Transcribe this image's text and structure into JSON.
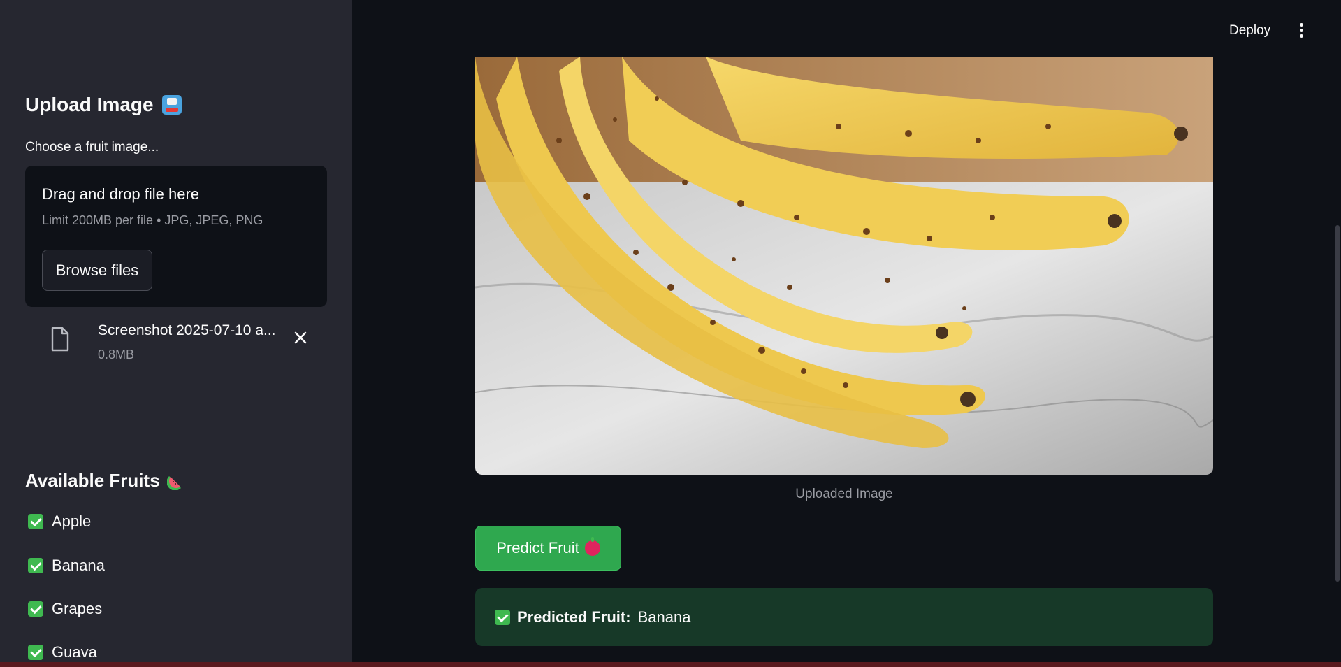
{
  "sidebar": {
    "upload_title": "Upload Image",
    "choose_label": "Choose a fruit image...",
    "dropzone": {
      "title": "Drag and drop file here",
      "limit": "Limit 200MB per file • JPG, JPEG, PNG",
      "browse_label": "Browse files"
    },
    "file": {
      "name": "Screenshot 2025-07-10 a...",
      "size": "0.8MB"
    },
    "fruits_title": "Available Fruits",
    "fruits": [
      "Apple",
      "Banana",
      "Grapes",
      "Guava"
    ]
  },
  "header": {
    "deploy_label": "Deploy"
  },
  "main": {
    "image_caption": "Uploaded Image",
    "predict_label": "Predict Fruit",
    "result_label": "Predicted Fruit:",
    "result_value": "Banana"
  },
  "colors": {
    "sidebar_bg": "#262730",
    "main_bg": "#0e1117",
    "accent_green": "#2fa84f",
    "success_bg": "#173928"
  }
}
